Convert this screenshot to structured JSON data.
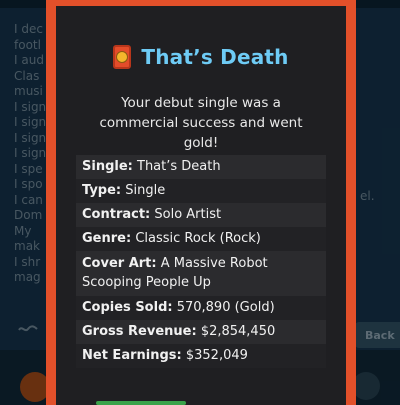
{
  "modal": {
    "title": "That’s Death",
    "icon": "gold-record-award-icon",
    "description": "Your debut single was a commercial success and went gold!",
    "details": [
      {
        "key": "Single:",
        "value": "That’s Death"
      },
      {
        "key": "Type:",
        "value": "Single"
      },
      {
        "key": "Contract:",
        "value": "Solo Artist"
      },
      {
        "key": "Genre:",
        "value": "Classic Rock (Rock)"
      },
      {
        "key": "Cover Art:",
        "value": "A Massive Robot Scooping People Up"
      },
      {
        "key": "Copies Sold:",
        "value": "570,890 (Gold)"
      },
      {
        "key": "Gross Revenue:",
        "value": "$2,854,450"
      },
      {
        "key": "Net Earnings:",
        "value": "$352,049"
      }
    ]
  },
  "colors": {
    "modal_border": "#e2502a",
    "title": "#6ecbf5",
    "modal_bg": "#1f1f22"
  },
  "background": {
    "feed_fragments": [
      "I dec",
      "footl",
      "I aud",
      "Clas",
      "musi",
      "I sign",
      "I sign",
      "I sign",
      "I sign",
      "I spe",
      "I spo",
      "I can",
      "Dom",
      "My",
      "mak",
      "I shr",
      "mag"
    ],
    "right_fragment": "el.",
    "back_button": "Back"
  }
}
